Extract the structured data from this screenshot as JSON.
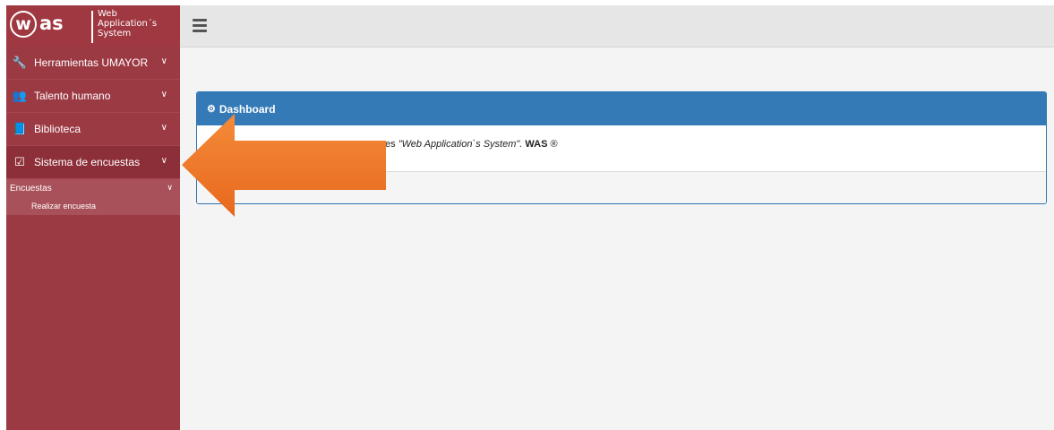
{
  "logo": {
    "mark": "w",
    "brand": "as",
    "tagline": [
      "Web",
      "Application´s",
      "System"
    ]
  },
  "sidebar": {
    "items": [
      {
        "icon": "wrench-icon",
        "glyph": "🔧",
        "label": "Herramientas UMAYOR"
      },
      {
        "icon": "users-icon",
        "glyph": "👥",
        "label": "Talento humano"
      },
      {
        "icon": "book-icon",
        "glyph": "📘",
        "label": "Biblioteca"
      },
      {
        "icon": "checkbox-icon",
        "glyph": "☑",
        "label": "Sistema de encuestas"
      }
    ],
    "sub": {
      "label": "Encuestas",
      "children": [
        "Realizar encuesta"
      ]
    }
  },
  "panel": {
    "title": "Dashboard",
    "body_prefix": "es ",
    "body_italic": "\"Web Application`s System\".",
    "body_bold": "WAS",
    "body_suffix": " ®"
  },
  "colors": {
    "sidebar": "#9c3a44",
    "panel_head": "#337ab7",
    "arrow": "#f07a2a"
  }
}
